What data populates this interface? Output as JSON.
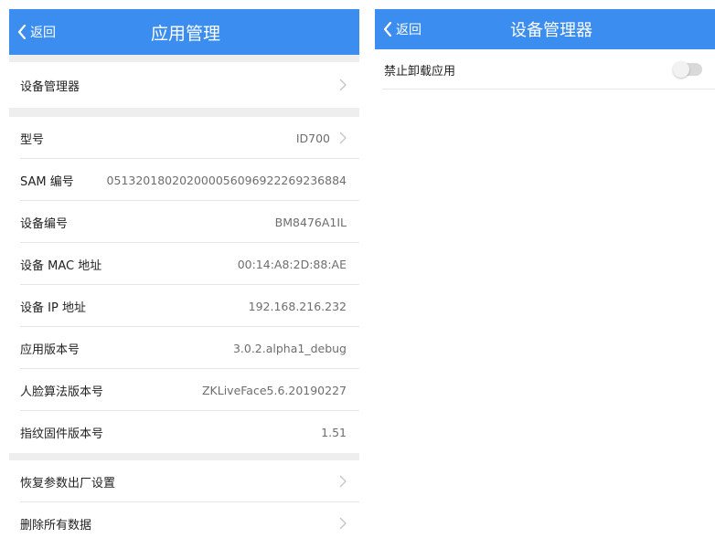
{
  "left": {
    "header": {
      "back_label": "返回",
      "title": "应用管理"
    },
    "device_manager": {
      "label": "设备管理器"
    },
    "model": {
      "label": "型号",
      "value": "ID700"
    },
    "sam": {
      "label": "SAM 编号",
      "value": "0513201802020000560969222692368​84"
    },
    "serial": {
      "label": "设备编号",
      "value": "BM8476A1IL"
    },
    "mac": {
      "label": "设备 MAC 地址",
      "value": "00:14:A8:2D:88:AE"
    },
    "ip": {
      "label": "设备 IP 地址",
      "value": "192.168.216.232"
    },
    "app_version": {
      "label": "应用版本号",
      "value": "3.0.2.alpha1_debug"
    },
    "face_version": {
      "label": "人脸算法版本号",
      "value": "ZKLiveFace5.6.20190227"
    },
    "fp_version": {
      "label": "指纹固件版本号",
      "value": "1.51"
    },
    "restore": {
      "label": "恢复参数出厂设置"
    },
    "delete_all": {
      "label": "删除所有数据"
    }
  },
  "right": {
    "header": {
      "back_label": "返回",
      "title": "设备管理器"
    },
    "disable_uninstall": {
      "label": "禁止卸载应用",
      "enabled": false
    }
  },
  "colors": {
    "header_blue": "#3b8df0",
    "section_gap": "#eeeeee",
    "value_gray": "#6e6e6e"
  },
  "icons": {
    "back": "chevron-left-icon",
    "row_arrow": "chevron-right-icon"
  }
}
